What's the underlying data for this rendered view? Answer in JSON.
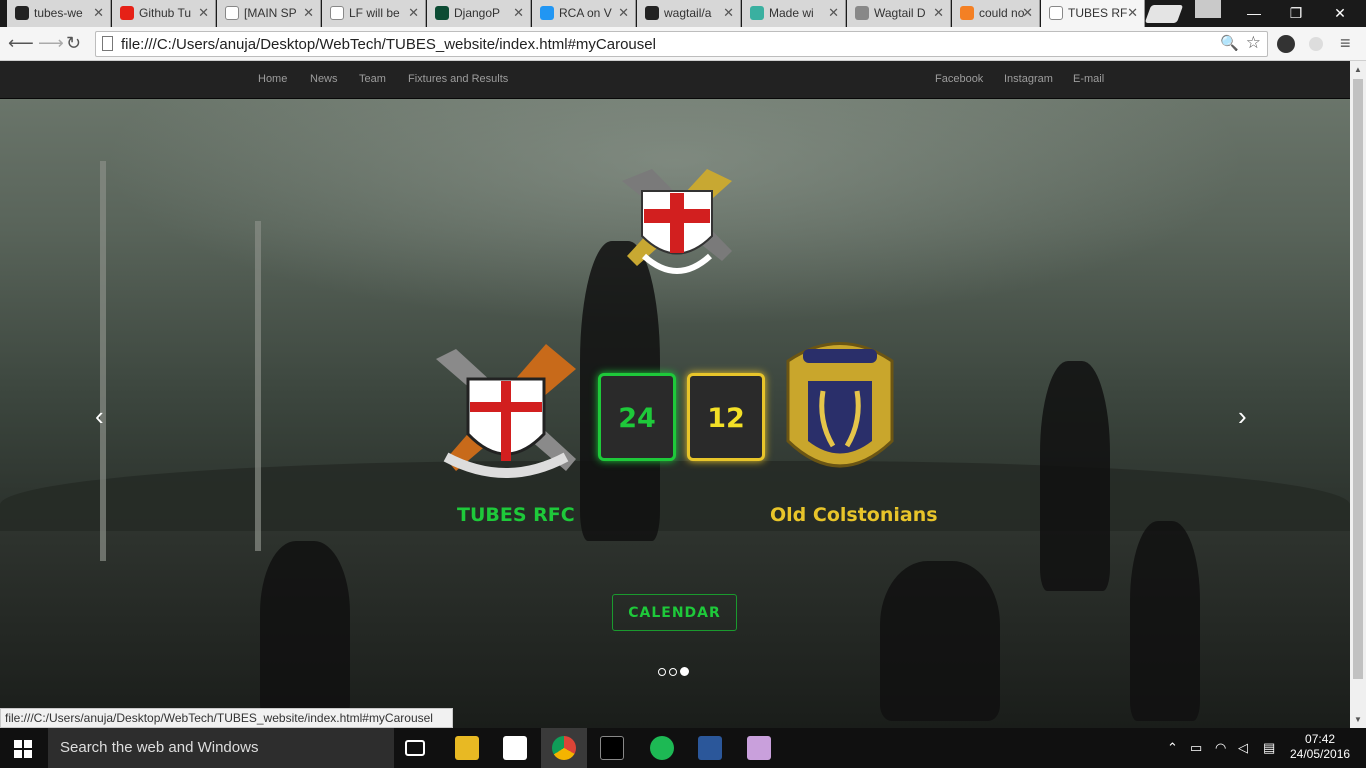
{
  "browser": {
    "tabs": [
      {
        "label": "tubes-we",
        "icon": "github-icon"
      },
      {
        "label": "Github Tu",
        "icon": "youtube-icon"
      },
      {
        "label": "[MAIN SP",
        "icon": "reddit-icon"
      },
      {
        "label": "LF will be",
        "icon": "document-icon"
      },
      {
        "label": "DjangoP",
        "icon": "django-icon"
      },
      {
        "label": "RCA on V",
        "icon": "pause-icon"
      },
      {
        "label": "wagtail/a",
        "icon": "github-icon"
      },
      {
        "label": "Made wi",
        "icon": "pen-icon"
      },
      {
        "label": "Wagtail D",
        "icon": "bird-icon"
      },
      {
        "label": "could no",
        "icon": "stackoverflow-icon"
      },
      {
        "label": "TUBES RF",
        "icon": "page-icon"
      }
    ],
    "url": "file:///C:/Users/anuja/Desktop/WebTech/TUBES_website/index.html#myCarousel",
    "status_url": "file:///C:/Users/anuja/Desktop/WebTech/TUBES_website/index.html#myCarousel"
  },
  "nav": {
    "left": [
      "Home",
      "News",
      "Team",
      "Fixtures and Results"
    ],
    "right": [
      "Facebook",
      "Instagram",
      "E-mail"
    ]
  },
  "match": {
    "home_team": "TUBES RFC",
    "away_team": "Old Colstonians",
    "home_score": "24",
    "away_score": "12",
    "home_color": "#1ec93a",
    "away_color": "#e8c52a"
  },
  "calendar_label": "CALENDAR",
  "carousel": {
    "slides": 3,
    "active": 3
  },
  "taskbar": {
    "search_placeholder": "Search the web and Windows",
    "time": "07:42",
    "date": "24/05/2016"
  }
}
